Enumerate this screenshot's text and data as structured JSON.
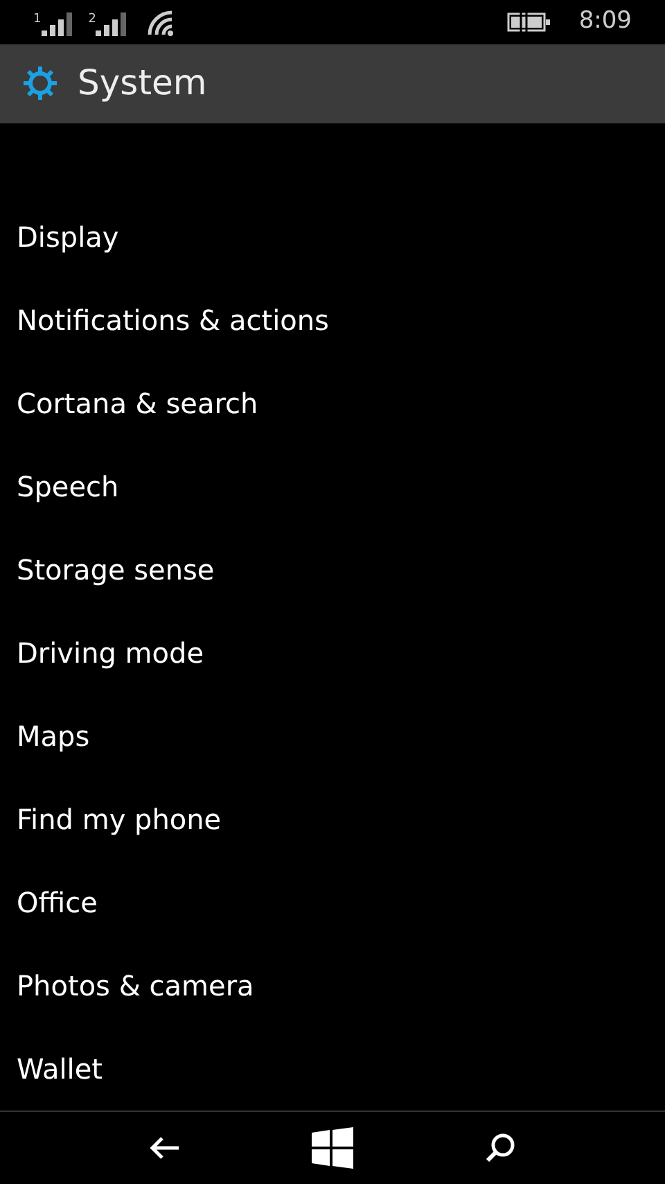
{
  "status_bar": {
    "sim_1": "1",
    "sim_2": "2",
    "time": "8:09"
  },
  "header": {
    "title": "System"
  },
  "menu_items": [
    {
      "label": "Display"
    },
    {
      "label": "Notifications & actions"
    },
    {
      "label": "Cortana & search"
    },
    {
      "label": "Speech"
    },
    {
      "label": "Storage sense"
    },
    {
      "label": "Driving mode"
    },
    {
      "label": "Maps"
    },
    {
      "label": "Find my phone"
    },
    {
      "label": "Office"
    },
    {
      "label": "Photos & camera"
    },
    {
      "label": "Wallet"
    }
  ]
}
